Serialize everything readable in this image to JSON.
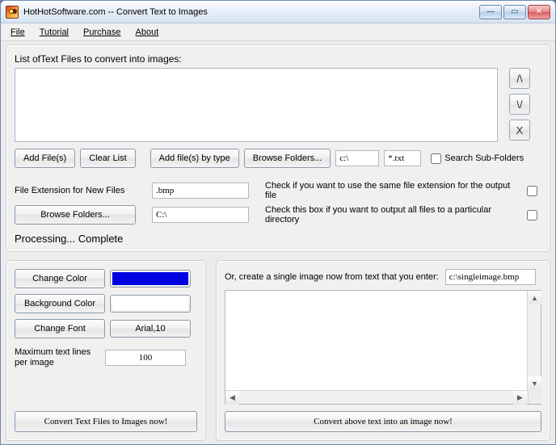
{
  "window": {
    "title": "HotHotSoftware.com -- Convert Text to Images"
  },
  "menu": {
    "file": "File",
    "tutorial": "Tutorial",
    "purchase": "Purchase",
    "about": "About"
  },
  "top": {
    "list_label": "List ofText Files to convert into images:",
    "btn_up": "/\\",
    "btn_down": "\\/",
    "btn_del": "X",
    "add_files": "Add File(s)",
    "clear_list": "Clear List",
    "add_by_type": "Add file(s) by type",
    "browse_folders": "Browse Folders...",
    "path": "c:\\",
    "ext": "*.txt",
    "search_sub": "Search Sub-Folders",
    "fe_label": "File Extension for New Files",
    "fe_value": ".bmp",
    "fe_check": "Check if you want to use the same file extension for the output file",
    "browse_folders2": "Browse Folders...",
    "out_dir": "C:\\",
    "out_check": "Check this box if you want to output all files to a particular directory",
    "processing": "Processing... Complete"
  },
  "left": {
    "change_color": "Change Color",
    "bg_color": "Background Color",
    "change_font": "Change Font",
    "font_value": "Arial,10",
    "max_label": "Maximum text lines per image",
    "max_value": "100",
    "convert_btn": "Convert Text Files to Images now!"
  },
  "right": {
    "header": "Or, create a single image now from text that you enter:",
    "outfile": "c:\\singleimage.bmp",
    "convert_btn": "Convert above text into an image now!"
  },
  "colors": {
    "fg": "#0000e0",
    "bg": "#ffffff"
  }
}
